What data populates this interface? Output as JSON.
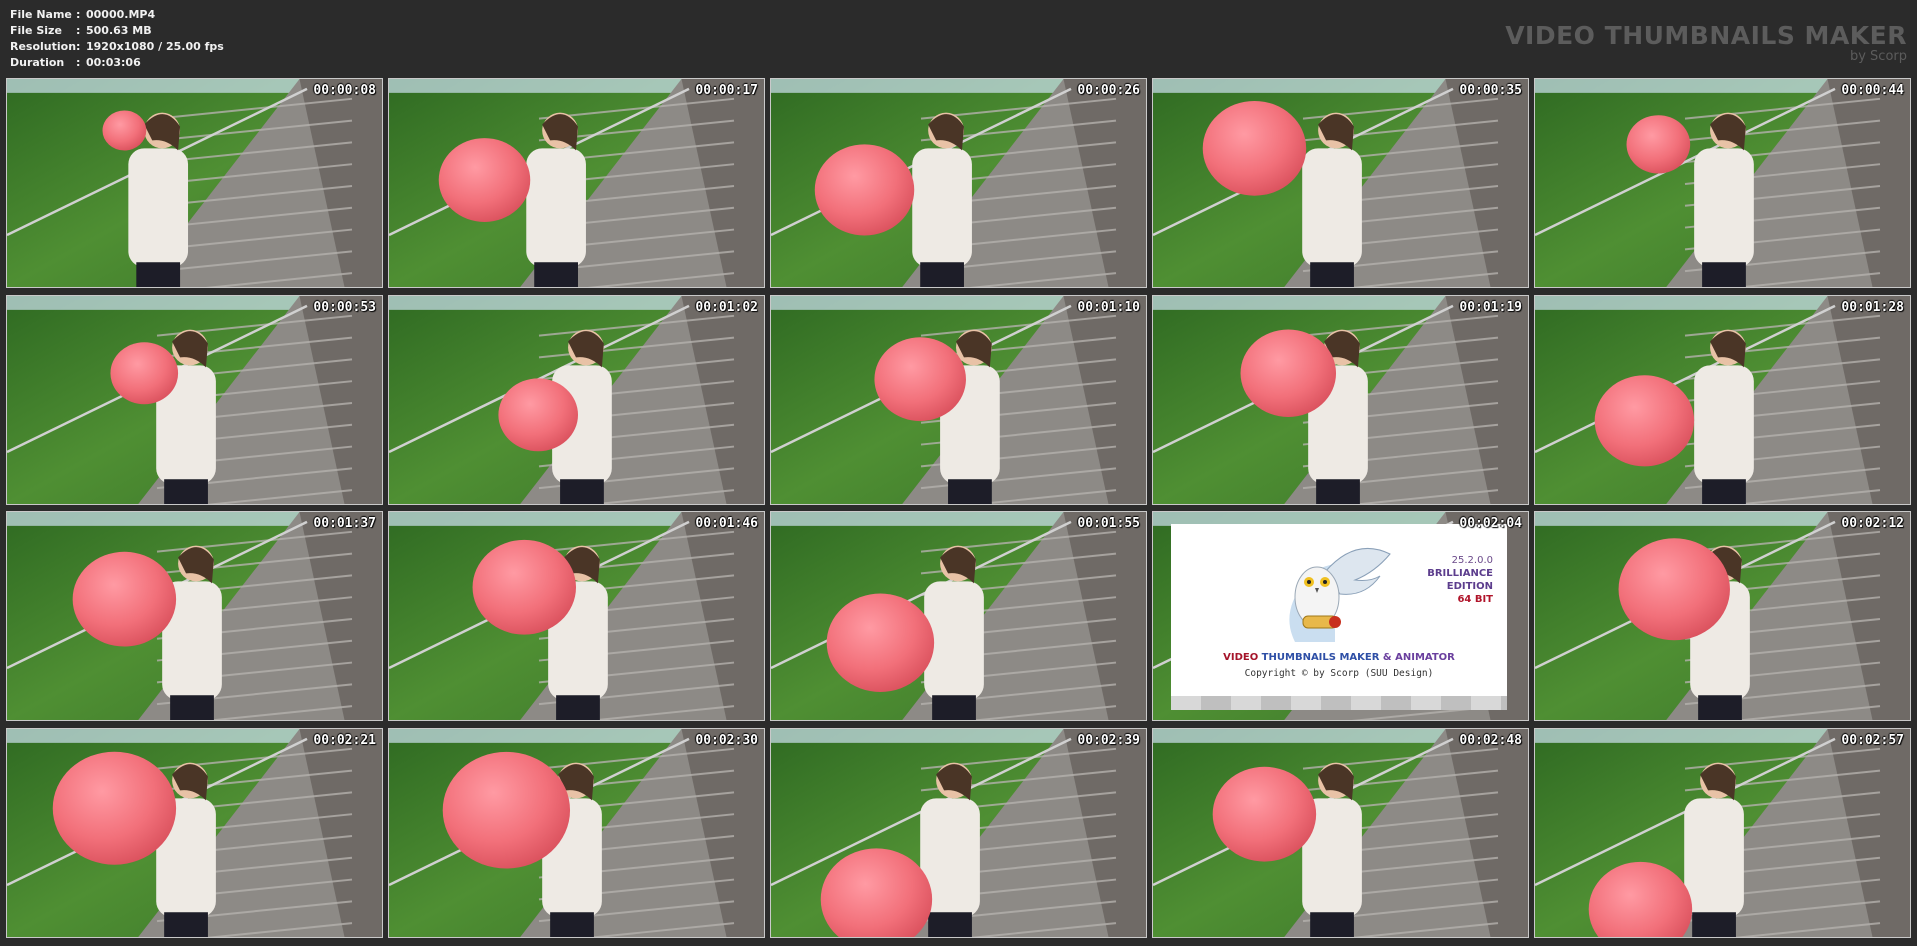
{
  "file_info": [
    {
      "label": "File Name",
      "value": "00000.MP4"
    },
    {
      "label": "File Size",
      "value": "500.63 MB"
    },
    {
      "label": "Resolution",
      "value": "1920x1080 / 25.00 fps"
    },
    {
      "label": "Duration",
      "value": "00:03:06"
    }
  ],
  "brand": {
    "title": "VIDEO THUMBNAILS MAKER",
    "subtitle": "by Scorp"
  },
  "separator": ":",
  "thumbnails": [
    {
      "time": "00:00:08"
    },
    {
      "time": "00:00:17"
    },
    {
      "time": "00:00:26"
    },
    {
      "time": "00:00:35"
    },
    {
      "time": "00:00:44"
    },
    {
      "time": "00:00:53"
    },
    {
      "time": "00:01:02"
    },
    {
      "time": "00:01:10"
    },
    {
      "time": "00:01:19"
    },
    {
      "time": "00:01:28"
    },
    {
      "time": "00:01:37"
    },
    {
      "time": "00:01:46"
    },
    {
      "time": "00:01:55"
    },
    {
      "time": "00:02:04"
    },
    {
      "time": "00:02:12"
    },
    {
      "time": "00:02:21"
    },
    {
      "time": "00:02:30"
    },
    {
      "time": "00:02:39"
    },
    {
      "time": "00:02:48"
    },
    {
      "time": "00:02:57"
    }
  ],
  "logo_card": {
    "index": 13,
    "version": "25.2.0.0",
    "edition_line1": "BRILLIANCE",
    "edition_line2": "EDITION",
    "bits": "64 BIT",
    "product_part1": "VIDEO",
    "product_part2": " THUMBNAILS MAKER",
    "product_part3": " & ANIMATOR",
    "copyright": "Copyright © by Scorp (SUU Design)"
  },
  "colors": {
    "background": "#2b2b2b",
    "thumb_border": "#c9c9c9",
    "balloon": "#f2707a",
    "foliage": "#3f7a2c",
    "stairs": "#8d8a86"
  }
}
